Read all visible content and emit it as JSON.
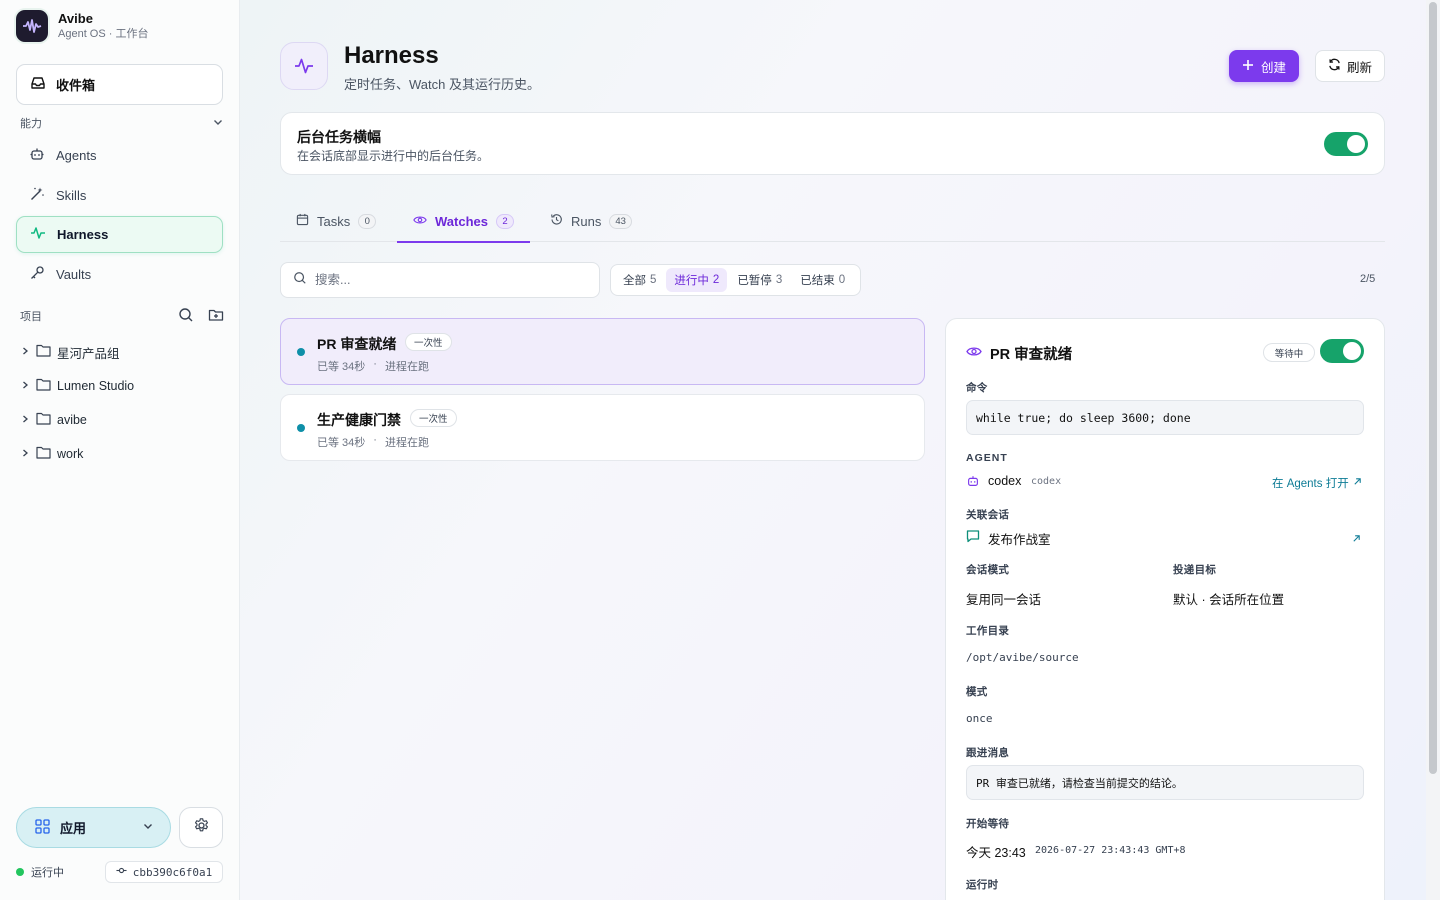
{
  "brand": {
    "name": "Avibe",
    "subtitle": "Agent OS · 工作台"
  },
  "sidebar": {
    "inbox_label": "收件箱",
    "capabilities_heading": "能力",
    "nav": [
      {
        "label": "Agents",
        "icon": "robot-icon"
      },
      {
        "label": "Skills",
        "icon": "magic-wand-icon"
      },
      {
        "label": "Harness",
        "icon": "activity-pulse-icon",
        "active": true
      },
      {
        "label": "Vaults",
        "icon": "key-icon"
      }
    ],
    "projects_heading": "项目",
    "projects": [
      "星河产品组",
      "Lumen Studio",
      "avibe",
      "work"
    ],
    "apps_label": "应用",
    "status_label": "运行中",
    "commit": "cbb390c6f0a1"
  },
  "header": {
    "title": "Harness",
    "subtitle": "定时任务、Watch 及其运行历史。",
    "create_label": "创建",
    "refresh_label": "刷新"
  },
  "banner": {
    "title": "后台任务横幅",
    "subtitle": "在会话底部显示进行中的后台任务。",
    "enabled": true
  },
  "tabs": [
    {
      "label": "Tasks",
      "count": "0"
    },
    {
      "label": "Watches",
      "count": "2",
      "active": true
    },
    {
      "label": "Runs",
      "count": "43"
    }
  ],
  "search": {
    "placeholder": "搜索..."
  },
  "filters": [
    {
      "label": "全部",
      "count": "5"
    },
    {
      "label": "进行中",
      "count": "2",
      "active": true
    },
    {
      "label": "已暂停",
      "count": "3"
    },
    {
      "label": "已结束",
      "count": "0"
    }
  ],
  "pagination": "2/5",
  "watches": [
    {
      "name": "PR 审查就绪",
      "tag": "一次性",
      "waited": "已等 34秒",
      "status": "进程在跑",
      "selected": true
    },
    {
      "name": "生产健康门禁",
      "tag": "一次性",
      "waited": "已等 34秒",
      "status": "进程在跑"
    }
  ],
  "detail": {
    "title": "PR 审查就绪",
    "status": "等待中",
    "enabled": true,
    "command_label": "命令",
    "command": "while true; do sleep 3600; done",
    "agent_label": "AGENT",
    "agent_name": "codex",
    "agent_id": "codex",
    "open_in_agents": "在 Agents 打开",
    "session_label": "关联会话",
    "session_name": "发布作战室",
    "session_mode_label": "会话模式",
    "session_mode": "复用同一会话",
    "delivery_label": "投递目标",
    "delivery": "默认 · 会话所在位置",
    "workdir_label": "工作目录",
    "workdir": "/opt/avibe/source",
    "mode_label": "模式",
    "mode": "once",
    "followup_label": "跟进消息",
    "followup": "PR 审查已就绪，请检查当前提交的结论。",
    "started_label": "开始等待",
    "started_short": "今天 23:43",
    "started_full": "2026-07-27 23:43:43 GMT+8",
    "runtime_label": "运行时"
  },
  "colors": {
    "accent": "#7c3aed",
    "toggle_on": "#16a36a",
    "active_nav_bg": "#ecfaf3",
    "link": "#0e7c96"
  }
}
